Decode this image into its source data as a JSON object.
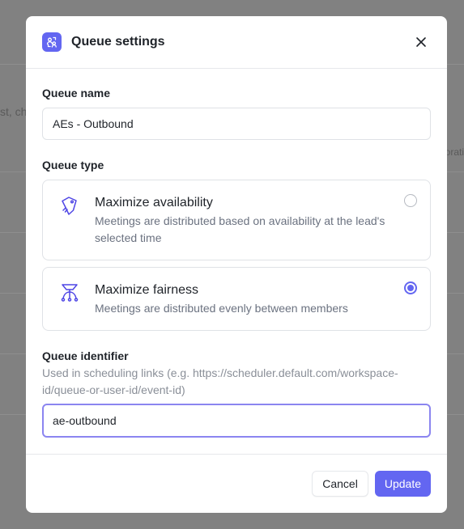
{
  "background": {
    "left_text": "st, cha",
    "right_text": "orati"
  },
  "modal": {
    "title": "Queue settings",
    "header_icon": "queue-users-icon",
    "close_icon": "close-icon",
    "queue_name": {
      "label": "Queue name",
      "value": "AEs - Outbound"
    },
    "queue_type": {
      "label": "Queue type",
      "options": [
        {
          "icon": "tag-icon",
          "title": "Maximize availability",
          "description": "Meetings are distributed based on availability at the lead's selected time",
          "selected": false
        },
        {
          "icon": "distribution-icon",
          "title": "Maximize fairness",
          "description": "Meetings are distributed evenly between members",
          "selected": true
        }
      ]
    },
    "queue_identifier": {
      "label": "Queue identifier",
      "helper_line1": "Used in scheduling links (e.g. https://scheduler.default.com/workspace-",
      "helper_line2": "id/queue-or-user-id/event-id)",
      "value": "ae-outbound"
    },
    "footer": {
      "cancel_label": "Cancel",
      "update_label": "Update"
    },
    "colors": {
      "accent": "#6366f1",
      "focus_border": "#8b85f0"
    }
  }
}
